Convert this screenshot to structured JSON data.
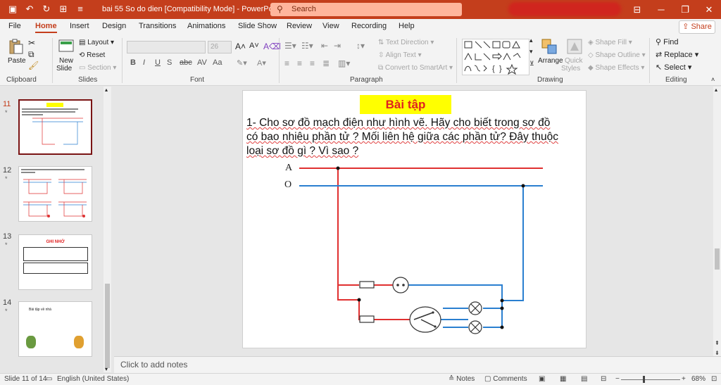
{
  "titlebar": {
    "title": "bai 55 So do dien [Compatibility Mode]  -  PowerPoint",
    "search_placeholder": "Search",
    "qat": [
      "save-icon",
      "undo-icon",
      "redo-icon",
      "present-icon",
      "customize-icon"
    ]
  },
  "menu": {
    "tabs": [
      "File",
      "Home",
      "Insert",
      "Design",
      "Transitions",
      "Animations",
      "Slide Show",
      "Review",
      "View",
      "Recording",
      "Help"
    ],
    "active": "Home",
    "share_label": "Share"
  },
  "ribbon": {
    "clipboard": {
      "label": "Clipboard",
      "paste": "Paste"
    },
    "slides": {
      "label": "Slides",
      "new_slide": "New",
      "new_slide2": "Slide",
      "layout": "Layout",
      "reset": "Reset",
      "section": "Section"
    },
    "font": {
      "label": "Font",
      "size": "26",
      "bold": "B",
      "italic": "I",
      "underline": "U",
      "strike": "S",
      "charspace": "AV",
      "case": "Aa"
    },
    "paragraph": {
      "label": "Paragraph",
      "text_direction": "Text Direction",
      "align_text": "Align Text",
      "smartart": "Convert to SmartArt"
    },
    "drawing": {
      "label": "Drawing",
      "arrange": "Arrange",
      "quick_styles": "Quick",
      "quick_styles2": "Styles",
      "shape_fill": "Shape Fill",
      "shape_outline": "Shape Outline",
      "shape_effects": "Shape Effects"
    },
    "editing": {
      "label": "Editing",
      "find": "Find",
      "replace": "Replace",
      "select": "Select"
    }
  },
  "thumbnails": [
    {
      "num": "11",
      "star": "*",
      "active": true
    },
    {
      "num": "12",
      "star": "*",
      "active": false
    },
    {
      "num": "13",
      "star": "*",
      "active": false,
      "heading": "GHI NHỚ"
    },
    {
      "num": "14",
      "star": "*",
      "active": false,
      "heading": "Bài tập về nhà"
    }
  ],
  "slide": {
    "title": "Bài tập",
    "lines": [
      "1- Cho sơ đồ mạch điện như hình vẽ. Hãy cho biết trong sơ đồ",
      "có bao nhiêu phần tử ? Mối liên hệ giữa các phần tử? Đây thuộc",
      "loại sơ đồ gì ? Vì sao ?"
    ],
    "wire_a": "A",
    "wire_o": "O",
    "colors": {
      "phase": "#e03030",
      "neutral": "#2a7fd0",
      "title_bg": "#ffff00",
      "title_fg": "#e02020"
    }
  },
  "notes_placeholder": "Click to add notes",
  "status": {
    "slide_info": "Slide 11 of 14",
    "language": "English (United States)",
    "notes": "Notes",
    "comments": "Comments",
    "zoom": "68%"
  }
}
